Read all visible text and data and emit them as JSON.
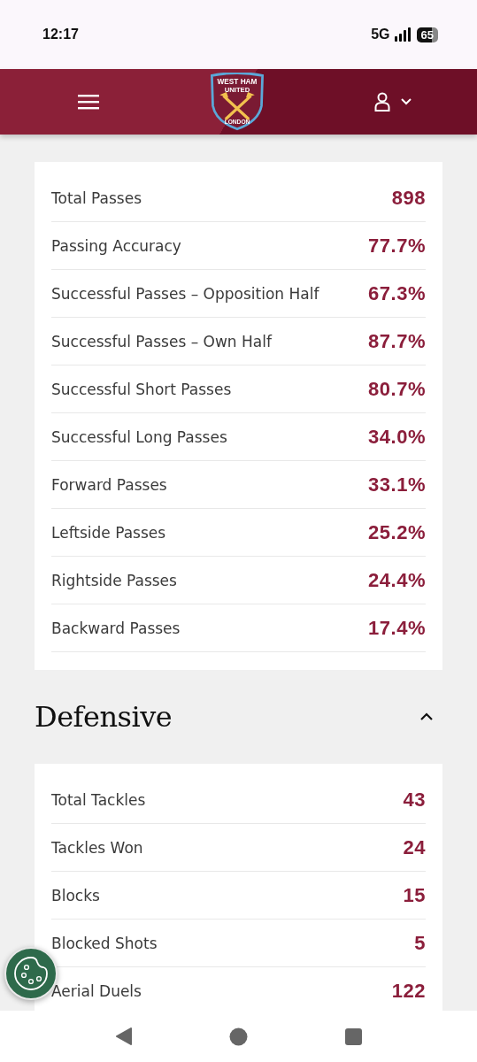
{
  "status_bar": {
    "time": "12:17",
    "network": "5G",
    "battery": "65"
  },
  "header": {
    "crest": {
      "top": "WEST HAM",
      "middle": "UNITED",
      "bottom": "LONDON"
    }
  },
  "sections": [
    {
      "rows": [
        {
          "label": "Total Passes",
          "value": "898"
        },
        {
          "label": "Passing Accuracy",
          "value": "77.7%"
        },
        {
          "label": "Successful Passes – Opposition Half",
          "value": "67.3%"
        },
        {
          "label": "Successful Passes – Own Half",
          "value": "87.7%"
        },
        {
          "label": "Successful Short Passes",
          "value": "80.7%"
        },
        {
          "label": "Successful Long Passes",
          "value": "34.0%"
        },
        {
          "label": "Forward Passes",
          "value": "33.1%"
        },
        {
          "label": "Leftside Passes",
          "value": "25.2%"
        },
        {
          "label": "Rightside Passes",
          "value": "24.4%"
        },
        {
          "label": "Backward Passes",
          "value": "17.4%"
        }
      ]
    },
    {
      "title": "Defensive",
      "expanded": true,
      "rows": [
        {
          "label": "Total Tackles",
          "value": "43"
        },
        {
          "label": "Tackles Won",
          "value": "24"
        },
        {
          "label": "Blocks",
          "value": "15"
        },
        {
          "label": "Blocked Shots",
          "value": "5"
        },
        {
          "label": "Aerial Duels",
          "value": "122"
        }
      ]
    }
  ]
}
